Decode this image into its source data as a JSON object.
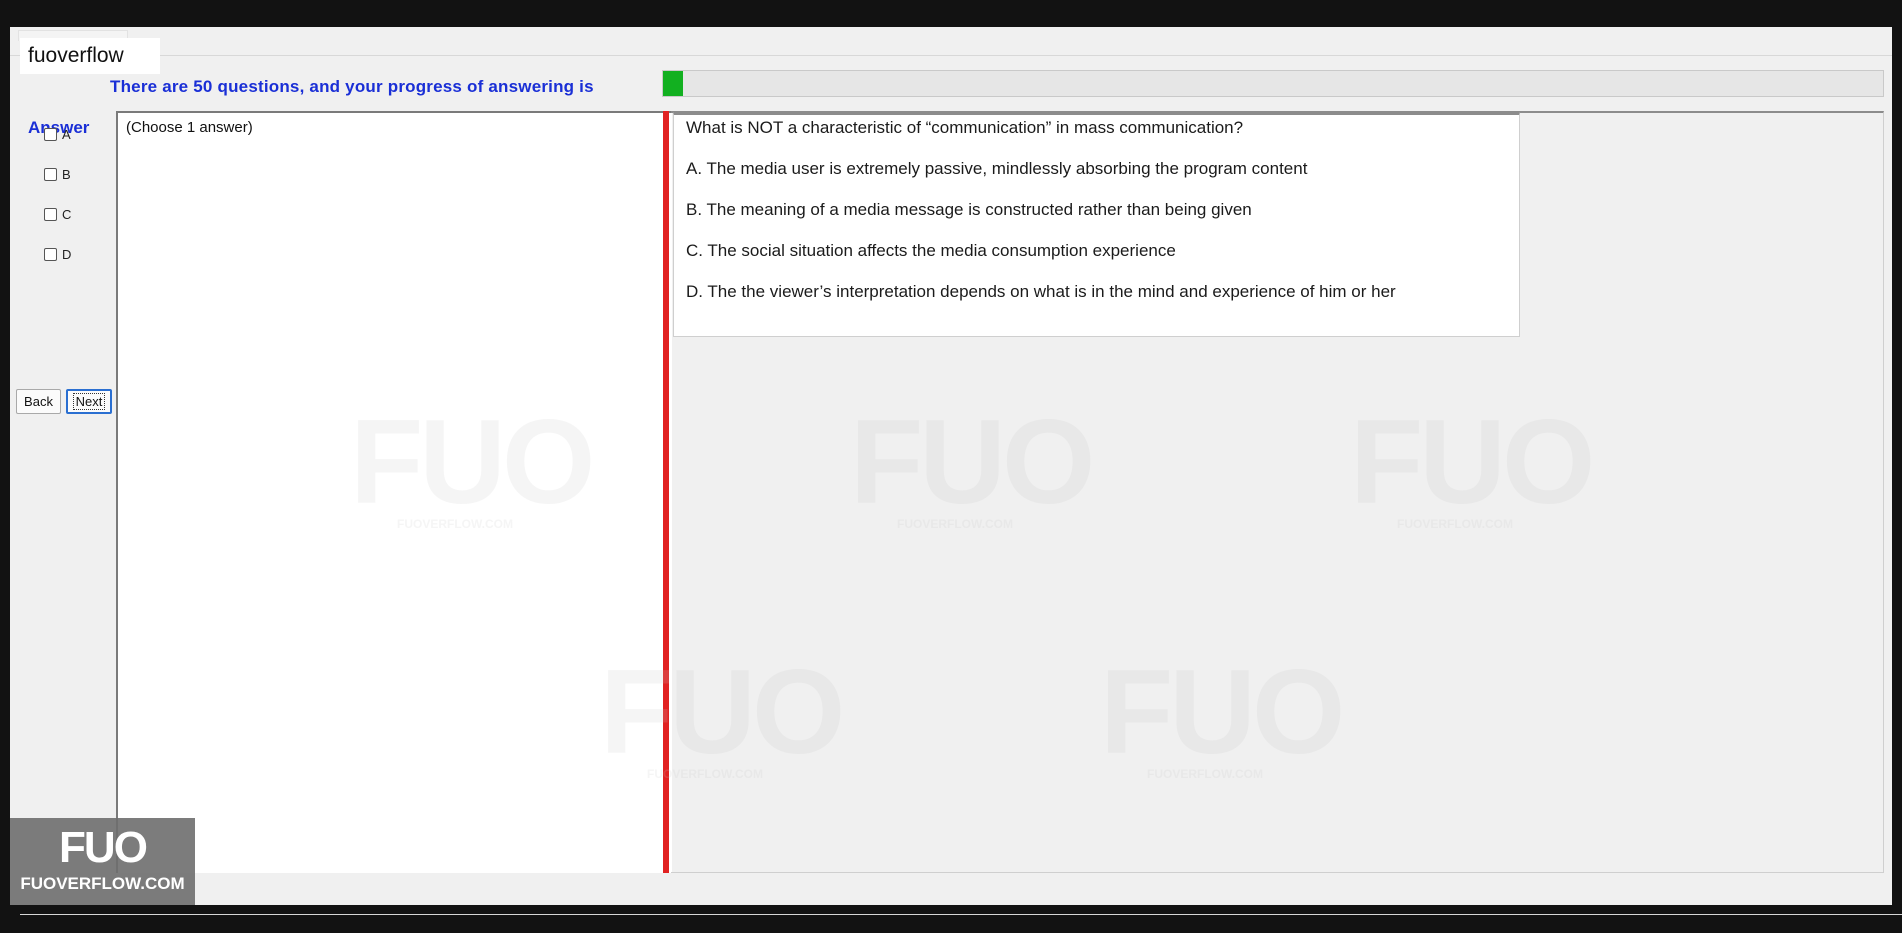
{
  "app": {
    "name": "fuoverflow"
  },
  "progress": {
    "label": "There are 50 questions, and your progress of answering is",
    "fraction": 0.016,
    "total_questions": 50
  },
  "answer_panel": {
    "heading": "Answer",
    "options": [
      "A",
      "B",
      "C",
      "D"
    ],
    "checked": [
      false,
      false,
      false,
      false
    ]
  },
  "nav": {
    "back_label": "Back",
    "next_label": "Next"
  },
  "answer_hint": "(Choose 1 answer)",
  "question": {
    "text": "What is NOT a characteristic of “communication” in mass communication?",
    "choices": [
      "A.  The media user is extremely passive, mindlessly absorbing the program content",
      "B.  The meaning of a media message is constructed rather than being given",
      "C.  The social situation affects the media consumption experience",
      "D.  The the viewer’s interpretation depends on what is in the mind and experience of him or her"
    ]
  },
  "watermark": {
    "logo": "FUO",
    "site": "FUOVERFLOW.COM"
  },
  "colors": {
    "accent_blue": "#1a2fd6",
    "progress_green": "#12b020",
    "divider_red": "#e12222"
  }
}
